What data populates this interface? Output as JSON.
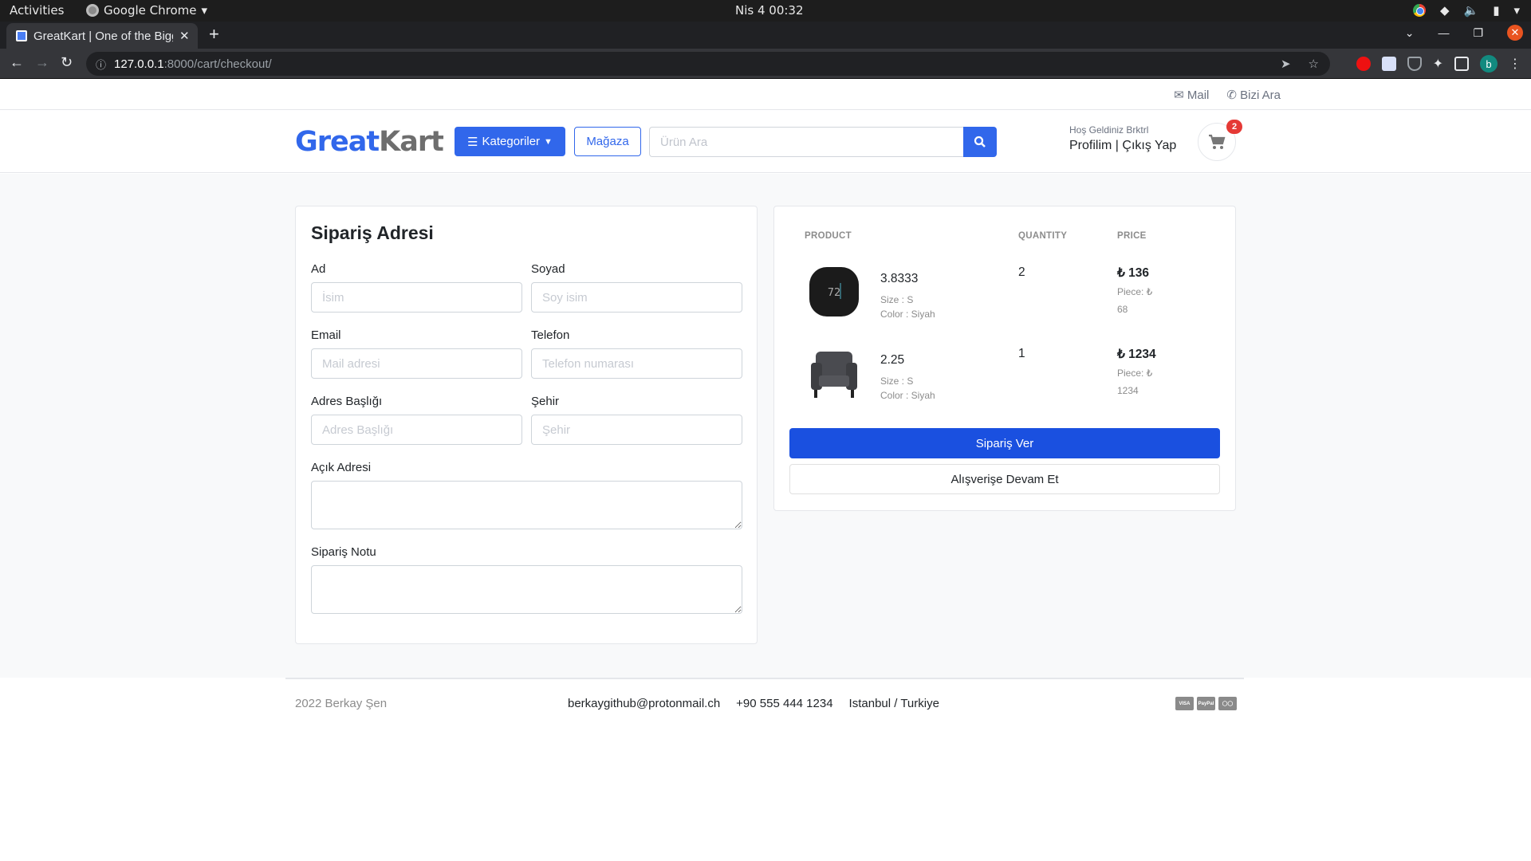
{
  "os": {
    "activities": "Activities",
    "app_name": "Google Chrome",
    "clock": "Nis 4  00:32"
  },
  "browser": {
    "tab_title": "GreatKart | One of the Biggest Online Shopping Platform",
    "url_host": "127.0.0.1",
    "url_path": ":8000/cart/checkout/",
    "profile_initial": "b"
  },
  "topbar": {
    "mail": "Mail",
    "call": "Bizi Ara"
  },
  "header": {
    "logo_part1": "Great",
    "logo_part2": "Kart",
    "categories_label": "Kategoriler",
    "store_label": "Mağaza",
    "search_placeholder": "Ürün Ara",
    "welcome": "Hoş Geldiniz Brktrl",
    "profile_link": "Profilim",
    "separator": "|",
    "logout_link": "Çıkış Yap",
    "cart_count": "2"
  },
  "address_form": {
    "title": "Sipariş Adresi",
    "fields": {
      "first_name": {
        "label": "Ad",
        "placeholder": "İsim",
        "value": ""
      },
      "last_name": {
        "label": "Soyad",
        "placeholder": "Soy isim",
        "value": ""
      },
      "email": {
        "label": "Email",
        "placeholder": "Mail adresi",
        "value": ""
      },
      "phone": {
        "label": "Telefon",
        "placeholder": "Telefon numarası",
        "value": ""
      },
      "address_title": {
        "label": "Adres Başlığı",
        "placeholder": "Adres Başlığı",
        "value": ""
      },
      "city": {
        "label": "Şehir",
        "placeholder": "Şehir",
        "value": ""
      },
      "full_address": {
        "label": "Açık Adresi",
        "value": ""
      },
      "order_note": {
        "label": "Sipariş Notu",
        "value": ""
      }
    }
  },
  "order_summary": {
    "columns": [
      "PRODUCT",
      "QUANTITY",
      "PRICE"
    ],
    "items": [
      {
        "name": "3.8333",
        "size": "Size : S",
        "color": "Color : Siyah",
        "quantity": "2",
        "total": "₺ 136",
        "piece_label": "Piece: ₺",
        "piece_price": "68",
        "image": "thermostat"
      },
      {
        "name": "2.25",
        "size": "Size : S",
        "color": "Color : Siyah",
        "quantity": "1",
        "total": "₺ 1234",
        "piece_label": "Piece: ₺",
        "piece_price": "1234",
        "image": "armchair"
      }
    ],
    "place_order": "Sipariş Ver",
    "continue_shopping": "Alışverişe Devam Et"
  },
  "footer": {
    "copyright": "2022 Berkay Şen",
    "email": "berkaygithub@protonmail.ch",
    "phone": "+90 555 444 1234",
    "location": "Istanbul / Turkiye",
    "payments": [
      "VISA",
      "PayPal",
      "MC"
    ]
  },
  "colors": {
    "brand_blue": "#3167eb",
    "order_button": "#1a50e0",
    "badge_red": "#e53935"
  }
}
